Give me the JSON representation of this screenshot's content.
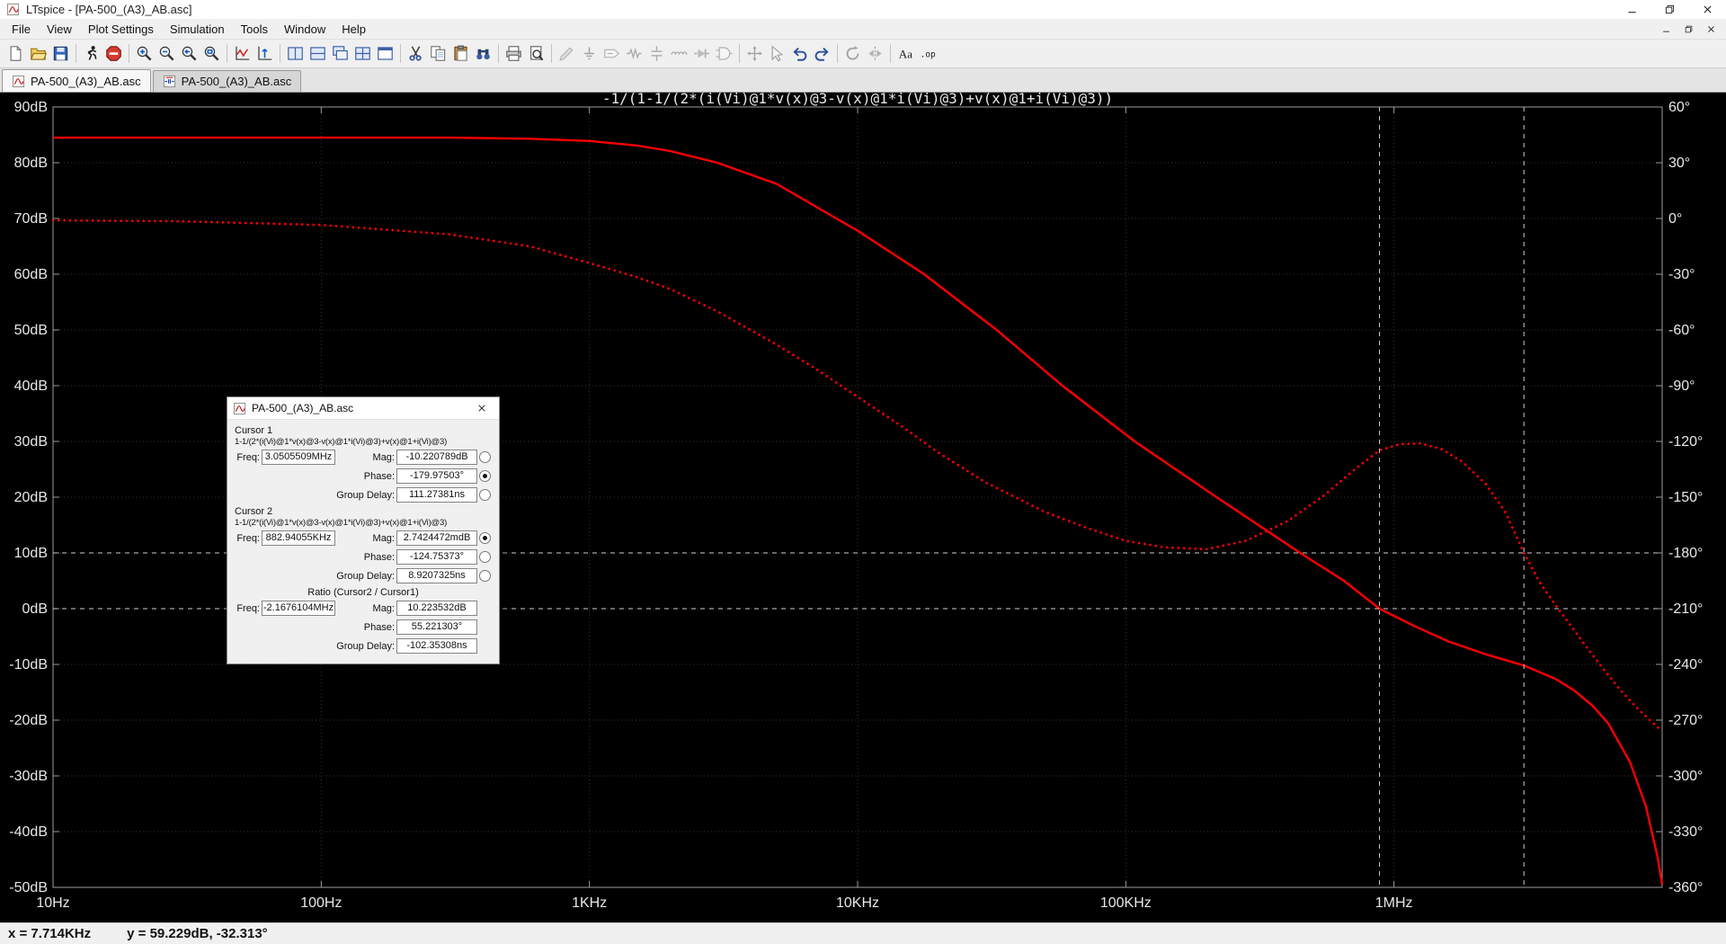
{
  "window": {
    "title": "LTspice - [PA-500_(A3)_AB.asc]",
    "controls": [
      {
        "name": "minimize"
      },
      {
        "name": "restore"
      },
      {
        "name": "close"
      }
    ]
  },
  "mdi_controls": [
    {
      "name": "minimize"
    },
    {
      "name": "restore"
    },
    {
      "name": "close"
    }
  ],
  "menu": {
    "items": [
      "File",
      "View",
      "Plot Settings",
      "Simulation",
      "Tools",
      "Window",
      "Help"
    ]
  },
  "toolbar": {
    "items": [
      {
        "name": "new-file",
        "enabled": true
      },
      {
        "name": "open-folder",
        "enabled": true
      },
      {
        "name": "save",
        "enabled": true
      },
      {
        "name": "run",
        "enabled": true,
        "sep_before": true
      },
      {
        "name": "halt",
        "enabled": true
      },
      {
        "name": "zoom-in",
        "enabled": true,
        "sep_before": true
      },
      {
        "name": "zoom-out",
        "enabled": true
      },
      {
        "name": "zoom-back",
        "enabled": true
      },
      {
        "name": "zoom-full",
        "enabled": true
      },
      {
        "name": "mark-data-point",
        "enabled": true,
        "sep_before": true
      },
      {
        "name": "autorange-y",
        "enabled": true
      },
      {
        "name": "tile-vertical",
        "enabled": true,
        "sep_before": true
      },
      {
        "name": "tile-horizontal",
        "enabled": true
      },
      {
        "name": "cascade-windows",
        "enabled": true
      },
      {
        "name": "split-pane",
        "enabled": true
      },
      {
        "name": "grid-pane",
        "enabled": true
      },
      {
        "name": "cut",
        "enabled": true,
        "sep_before": true
      },
      {
        "name": "copy",
        "enabled": true
      },
      {
        "name": "paste",
        "enabled": true
      },
      {
        "name": "find",
        "enabled": true
      },
      {
        "name": "print",
        "enabled": true,
        "sep_before": true
      },
      {
        "name": "print-preview",
        "enabled": true
      },
      {
        "name": "wire",
        "enabled": false,
        "sep_before": true
      },
      {
        "name": "ground",
        "enabled": false
      },
      {
        "name": "net-label",
        "enabled": false
      },
      {
        "name": "resistor",
        "enabled": false
      },
      {
        "name": "capacitor",
        "enabled": false
      },
      {
        "name": "inductor",
        "enabled": false
      },
      {
        "name": "diode",
        "enabled": false
      },
      {
        "name": "component",
        "enabled": false
      },
      {
        "name": "move",
        "enabled": false,
        "sep_before": true
      },
      {
        "name": "drag",
        "enabled": false
      },
      {
        "name": "undo",
        "enabled": true
      },
      {
        "name": "redo",
        "enabled": true
      },
      {
        "name": "rotate",
        "enabled": false,
        "sep_before": true
      },
      {
        "name": "mirror",
        "enabled": false
      },
      {
        "name": "text",
        "enabled": true,
        "sep_before": true
      },
      {
        "name": "spice-directive",
        "enabled": true
      }
    ]
  },
  "tabs": [
    {
      "label": "PA-500_(A3)_AB.asc",
      "icon": "waveform-file",
      "active": true
    },
    {
      "label": "PA-500_(A3)_AB.asc",
      "icon": "schematic-file",
      "active": false
    }
  ],
  "cursor_dialog": {
    "title": "PA-500_(A3)_AB.asc",
    "expression": "1-1/(2*(i(Vi)@1*v(x)@3-v(x)@1*i(Vi)@3)+v(x)@1+i(Vi)@3)",
    "labels": {
      "freq": "Freq:",
      "mag": "Mag:",
      "phase": "Phase:",
      "gd": "Group Delay:"
    },
    "cursor1": {
      "label": "Cursor 1",
      "freq": "3.0505509MHz",
      "mag": "-10.220789dB",
      "phase": "-179.97503°",
      "gd": "111.27381ns",
      "selected": "phase"
    },
    "cursor2": {
      "label": "Cursor 2",
      "freq": "882.94055KHz",
      "mag": "2.7424472mdB",
      "phase": "-124.75373°",
      "gd": "8.9207325ns",
      "selected": "mag"
    },
    "ratio": {
      "label": "Ratio (Cursor2 / Cursor1)",
      "freq": "-2.1676104MHz",
      "mag": "10.223532dB",
      "phase": "55.221303°",
      "gd": "-102.35308ns"
    }
  },
  "status_bar": {
    "x": "x = 7.714KHz",
    "y": "y = 59.229dB, -32.313°"
  },
  "chart_data": {
    "type": "line",
    "title": "-1/(1-1/(2*(i(Vi)@1*v(x)@3-v(x)@1*i(Vi)@3)+v(x)@1+i(Vi)@3))",
    "title_color": "#00e000",
    "background": "#000000",
    "grid": true,
    "legend_position": "none",
    "x_axis": {
      "scale": "log",
      "unit": "Hz",
      "min_hz": 10,
      "max_hz": 10000000,
      "tick_labels": [
        {
          "hz": 10,
          "label": "10Hz"
        },
        {
          "hz": 100,
          "label": "100Hz"
        },
        {
          "hz": 1000,
          "label": "1KHz"
        },
        {
          "hz": 10000,
          "label": "10KHz"
        },
        {
          "hz": 100000,
          "label": "100KHz"
        },
        {
          "hz": 1000000,
          "label": "1MHz"
        }
      ]
    },
    "y_left": {
      "unit": "dB",
      "min": -50,
      "max": 90,
      "step": 10,
      "ticks": [
        {
          "v": 90,
          "label": "90dB"
        },
        {
          "v": 80,
          "label": "80dB"
        },
        {
          "v": 70,
          "label": "70dB"
        },
        {
          "v": 60,
          "label": "60dB"
        },
        {
          "v": 50,
          "label": "50dB"
        },
        {
          "v": 40,
          "label": "40dB"
        },
        {
          "v": 30,
          "label": "30dB"
        },
        {
          "v": 20,
          "label": "20dB"
        },
        {
          "v": 10,
          "label": "10dB"
        },
        {
          "v": 0,
          "label": "0dB"
        },
        {
          "v": -10,
          "label": "-10dB"
        },
        {
          "v": -20,
          "label": "-20dB"
        },
        {
          "v": -30,
          "label": "-30dB"
        },
        {
          "v": -40,
          "label": "-40dB"
        },
        {
          "v": -50,
          "label": "-50dB"
        }
      ]
    },
    "y_right": {
      "unit": "°",
      "min": -360,
      "max": 60,
      "step": 30,
      "ticks": [
        {
          "v": 60,
          "label": "60°"
        },
        {
          "v": 30,
          "label": "30°"
        },
        {
          "v": 0,
          "label": "0°"
        },
        {
          "v": -30,
          "label": "-30°"
        },
        {
          "v": -60,
          "label": "-60°"
        },
        {
          "v": -90,
          "label": "-90°"
        },
        {
          "v": -120,
          "label": "-120°"
        },
        {
          "v": -150,
          "label": "-150°"
        },
        {
          "v": -180,
          "label": "-180°"
        },
        {
          "v": -210,
          "label": "-210°"
        },
        {
          "v": -240,
          "label": "-240°"
        },
        {
          "v": -270,
          "label": "-270°"
        },
        {
          "v": -300,
          "label": "-300°"
        },
        {
          "v": -330,
          "label": "-330°"
        },
        {
          "v": -360,
          "label": "-360°"
        }
      ]
    },
    "series": [
      {
        "name": "magnitude",
        "axis": "left",
        "style": "solid",
        "color": "#ff0000",
        "points": [
          [
            10,
            84.5
          ],
          [
            100,
            84.5
          ],
          [
            300,
            84.5
          ],
          [
            600,
            84.3
          ],
          [
            1000,
            83.9
          ],
          [
            1500,
            83.1
          ],
          [
            2000,
            82.1
          ],
          [
            3000,
            80.0
          ],
          [
            5000,
            76.2
          ],
          [
            7300,
            71.6
          ],
          [
            10000,
            67.8
          ],
          [
            17700,
            60
          ],
          [
            33000,
            50
          ],
          [
            58000,
            40
          ],
          [
            108000,
            30
          ],
          [
            218000,
            20
          ],
          [
            447000,
            10
          ],
          [
            650000,
            5
          ],
          [
            882940,
            0
          ],
          [
            1200000,
            -3.2
          ],
          [
            1600000,
            -5.9
          ],
          [
            2200000,
            -8.2
          ],
          [
            3050551,
            -10.2
          ],
          [
            4000000,
            -12.6
          ],
          [
            4700000,
            -14.7
          ],
          [
            5500000,
            -17.4
          ],
          [
            6300000,
            -20.6
          ],
          [
            7600000,
            -27.6
          ],
          [
            8700000,
            -35.5
          ],
          [
            9600000,
            -44.4
          ],
          [
            10000000,
            -49.5
          ]
        ]
      },
      {
        "name": "phase",
        "axis": "right",
        "style": "dotted",
        "color": "#ff0000",
        "points": [
          [
            10,
            -1
          ],
          [
            30,
            -1.5
          ],
          [
            100,
            -3.5
          ],
          [
            300,
            -8.5
          ],
          [
            600,
            -15
          ],
          [
            1000,
            -24
          ],
          [
            1500,
            -31.5
          ],
          [
            2000,
            -38
          ],
          [
            3000,
            -50
          ],
          [
            5000,
            -68
          ],
          [
            7000,
            -81
          ],
          [
            10000,
            -96
          ],
          [
            15000,
            -113
          ],
          [
            20000,
            -126
          ],
          [
            30000,
            -142
          ],
          [
            50000,
            -158
          ],
          [
            70000,
            -166
          ],
          [
            100000,
            -173.5
          ],
          [
            140000,
            -177
          ],
          [
            200000,
            -178
          ],
          [
            280000,
            -173.5
          ],
          [
            400000,
            -163
          ],
          [
            550000,
            -149
          ],
          [
            700000,
            -136
          ],
          [
            882940,
            -124.8
          ],
          [
            1050000,
            -121.5
          ],
          [
            1250000,
            -121
          ],
          [
            1500000,
            -124
          ],
          [
            1800000,
            -131
          ],
          [
            2200000,
            -143
          ],
          [
            2600000,
            -158
          ],
          [
            3050551,
            -180
          ],
          [
            3500000,
            -196
          ],
          [
            4000000,
            -208
          ],
          [
            5000000,
            -227
          ],
          [
            6000000,
            -242
          ],
          [
            7000000,
            -254
          ],
          [
            8000000,
            -263
          ],
          [
            9000000,
            -270
          ],
          [
            10000000,
            -276
          ]
        ]
      }
    ],
    "cursors": [
      {
        "name": "cursor1",
        "hz": 3050550.9,
        "axis": "right",
        "value": -179.97503
      },
      {
        "name": "cursor2",
        "hz": 882940.55,
        "axis": "left",
        "value": 0.0027424472
      }
    ]
  }
}
